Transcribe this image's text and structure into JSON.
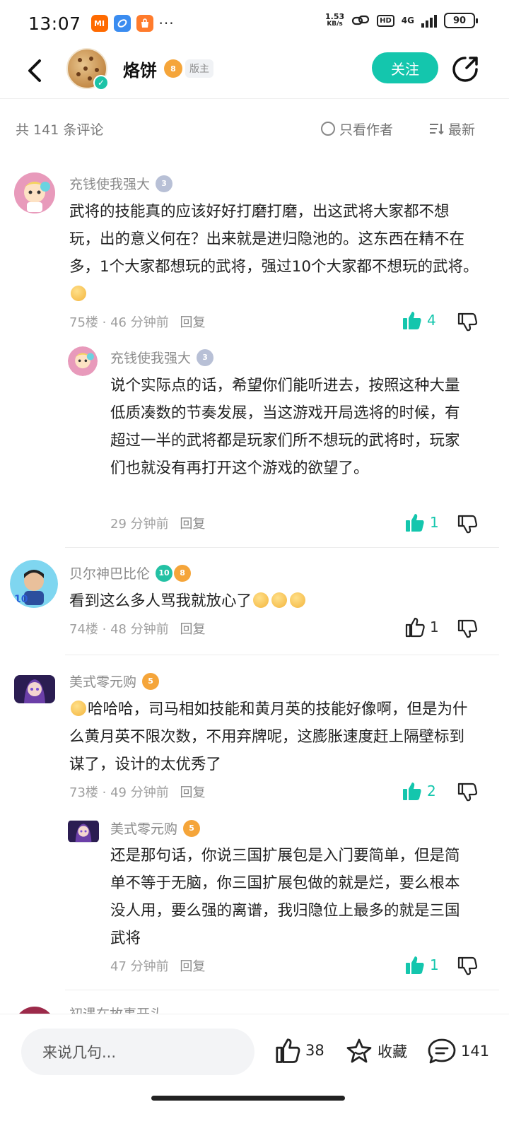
{
  "status_bar": {
    "time": "13:07",
    "apps": [
      {
        "icon": "mi-app-icon",
        "label": "MI",
        "color": "#ff6a00"
      },
      {
        "icon": "browser-app-icon",
        "label": "",
        "color": "#3a8cf0"
      },
      {
        "icon": "shop-app-icon",
        "label": "",
        "color": "#ff7b2c"
      }
    ],
    "more": "···",
    "net_speed": "1.53",
    "net_unit": "KB/s",
    "hd": "HD",
    "signal": "4G",
    "battery": "90"
  },
  "header": {
    "title": "烙饼",
    "level": "8",
    "role_tag": "版主",
    "follow_label": "关注"
  },
  "sort_bar": {
    "count": "共 141 条评论",
    "only_author": "只看作者",
    "sort": "最新"
  },
  "comments": [
    {
      "user": "充钱使我强大",
      "level": "3",
      "text": "武将的技能真的应该好好打磨打磨，出这武将大家都不想玩，出的意义何在？出来就是进归隐池的。这东西在精不在多，1个大家都想玩的武将，强过10个大家都不想玩的武将。",
      "floor": "75楼",
      "time": "46 分钟前",
      "reply": "回复",
      "likes": "4",
      "reply_item": {
        "user": "充钱使我强大",
        "level": "3",
        "text": "说个实际点的话，希望你们能听进去，按照这种大量低质凑数的节奏发展，当这游戏开局选将的时候，有超过一半的武将都是玩家们所不想玩的武将时，玩家们也就没有再打开这个游戏的欲望了。",
        "time": "29 分钟前",
        "reply": "回复",
        "likes": "1"
      }
    },
    {
      "user": "贝尔神巴比伦",
      "level_a": "10",
      "level_b": "8",
      "text": "看到这么多人骂我就放心了",
      "floor": "74楼",
      "time": "48 分钟前",
      "reply": "回复",
      "likes": "1"
    },
    {
      "user": "美式零元购",
      "level": "5",
      "text": "哈哈哈，司马相如技能和黄月英的技能好像啊，但是为什么黄月英不限次数，不用弃牌呢，这膨胀速度赶上隔壁标到谋了，设计的太优秀了",
      "floor": "73楼",
      "time": "49 分钟前",
      "reply": "回复",
      "likes": "2",
      "reply_item": {
        "user": "美式零元购",
        "level": "5",
        "text": "还是那句话，你说三国扩展包是入门要简单，但是简单不等于无脑，你三国扩展包做的就是烂，要么根本没人用，要么强的离谱，我归隐位上最多的就是三国武将",
        "time": "47 分钟前",
        "reply": "回复",
        "likes": "1"
      }
    },
    {
      "user": "初遇在故事开头"
    }
  ],
  "bottom_bar": {
    "input_placeholder": "来说几句...",
    "likes": "38",
    "favorite": "收藏",
    "comments": "141"
  }
}
